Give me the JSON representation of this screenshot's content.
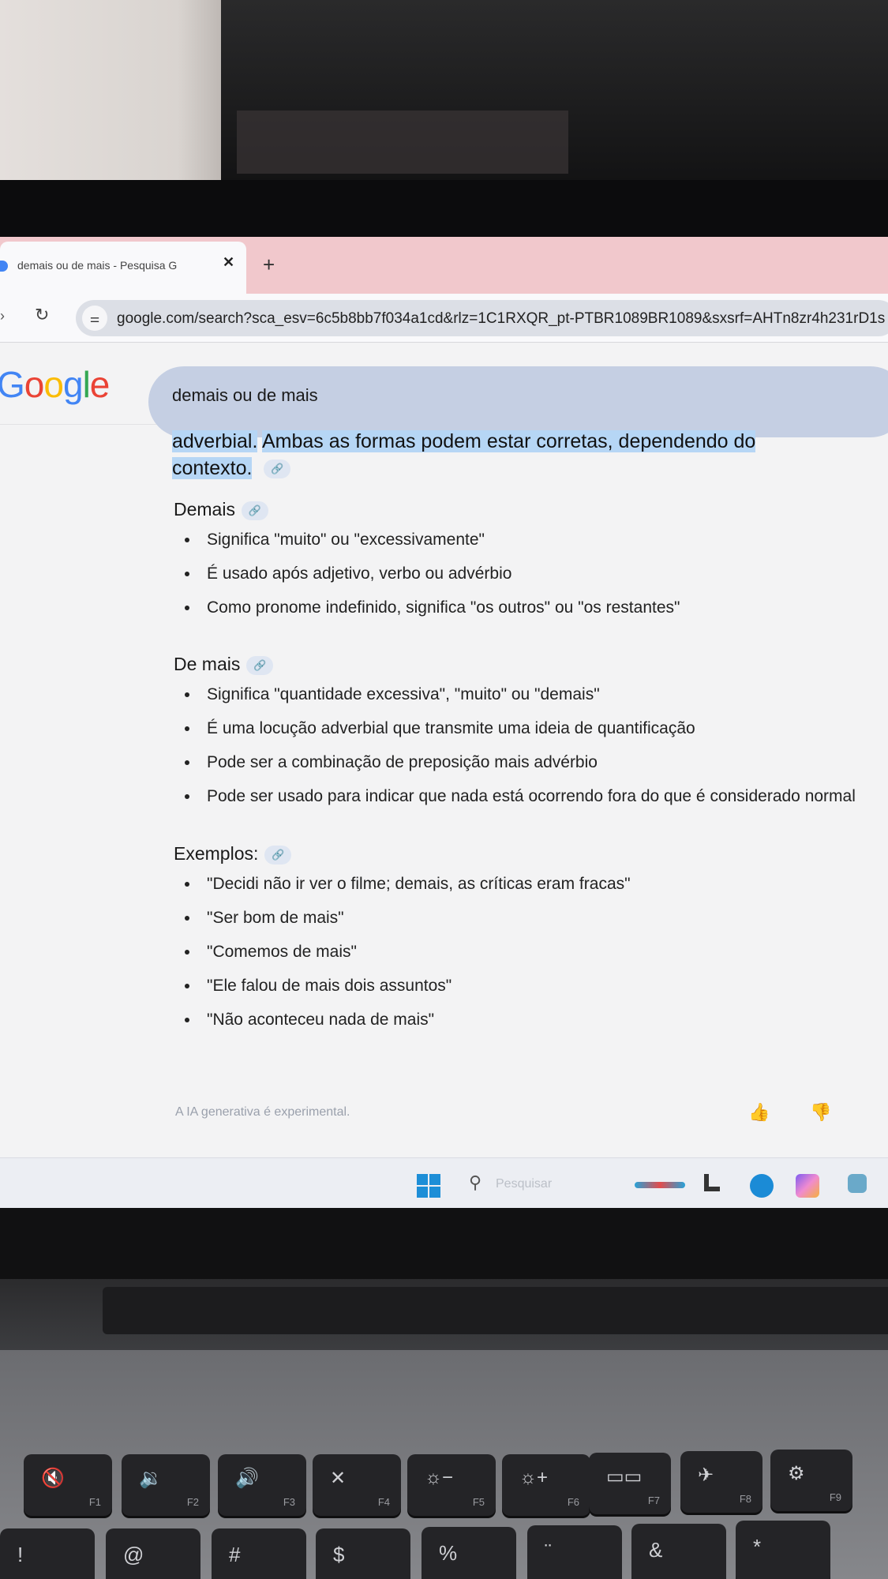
{
  "browser": {
    "tab_title": "demais ou de mais - Pesquisa G",
    "tab_close": "✕",
    "new_tab": "+",
    "url": "google.com/search?sca_esv=6c5b8bb7f034a1cd&rlz=1C1RXQR_pt-PTBR1089BR1089&sxsrf=AHTn8zr4h231rD1s"
  },
  "search": {
    "logo_letters": [
      "G",
      "o",
      "o",
      "g",
      "l",
      "e"
    ],
    "query": "demais ou de mais"
  },
  "overview": {
    "intro_part1": "adverbial.",
    "intro_part2": "Ambas as formas podem estar corretas, dependendo do contexto",
    "sections": [
      {
        "heading": "Demais",
        "items": [
          "Significa \"muito\" ou \"excessivamente\"",
          "É usado após adjetivo, verbo ou advérbio",
          "Como pronome indefinido, significa \"os outros\" ou \"os restantes\""
        ]
      },
      {
        "heading": "De mais",
        "items": [
          "Significa \"quantidade excessiva\", \"muito\" ou \"demais\"",
          "É uma locução adverbial que transmite uma ideia de quantificação",
          "Pode ser a combinação de preposição mais advérbio",
          "Pode ser usado para indicar que nada está ocorrendo fora do que é considerado normal"
        ]
      },
      {
        "heading": "Exemplos:",
        "items": [
          "\"Decidi não ir ver o filme; demais, as críticas eram fracas\"",
          "\"Ser bom de mais\"",
          "\"Comemos de mais\"",
          "\"Ele falou de mais dois assuntos\"",
          "\"Não aconteceu nada de mais\""
        ]
      }
    ],
    "disclaimer": "A IA generativa é experimental."
  },
  "taskbar": {
    "search_placeholder": "Pesquisar"
  },
  "keyboard": {
    "function_row": [
      {
        "glyph": "🔇",
        "fn": "F1"
      },
      {
        "glyph": "🔉",
        "fn": "F2"
      },
      {
        "glyph": "🔊",
        "fn": "F3"
      },
      {
        "glyph": "✕",
        "fn": "F4"
      },
      {
        "glyph": "☼−",
        "fn": "F5"
      },
      {
        "glyph": "☼+",
        "fn": "F6"
      },
      {
        "glyph": "▭▭",
        "fn": "F7"
      },
      {
        "glyph": "✈",
        "fn": "F8"
      },
      {
        "glyph": "⚙",
        "fn": "F9"
      }
    ],
    "number_row": [
      "!",
      "@",
      "#",
      "$",
      "%",
      "¨",
      "&",
      "*"
    ]
  },
  "colors": {
    "tab_strip": "#f1c8cc",
    "search_box": "#c5cfe3",
    "highlight": "#b6d6f5",
    "google_blue": "#4285f4",
    "google_red": "#ea4335",
    "google_yellow": "#fbbc05",
    "google_green": "#34a853"
  }
}
